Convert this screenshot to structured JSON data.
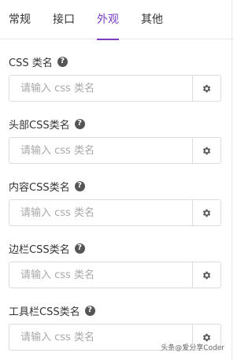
{
  "tabs": [
    {
      "label": "常规",
      "active": false
    },
    {
      "label": "接口",
      "active": false
    },
    {
      "label": "外观",
      "active": true
    },
    {
      "label": "其他",
      "active": false
    }
  ],
  "fields": [
    {
      "label": "CSS 类名",
      "placeholder": "请输入 css 类名"
    },
    {
      "label": "头部CSS类名",
      "placeholder": "请输入 css 类名"
    },
    {
      "label": "内容CSS类名",
      "placeholder": "请输入 css 类名"
    },
    {
      "label": "边栏CSS类名",
      "placeholder": "请输入 css 类名"
    },
    {
      "label": "工具栏CSS类名",
      "placeholder": "请输入 css 类名"
    }
  ],
  "watermark": "头条@爱分享Coder",
  "colors": {
    "accent": "#7b3fc4",
    "icon": "#555555"
  }
}
